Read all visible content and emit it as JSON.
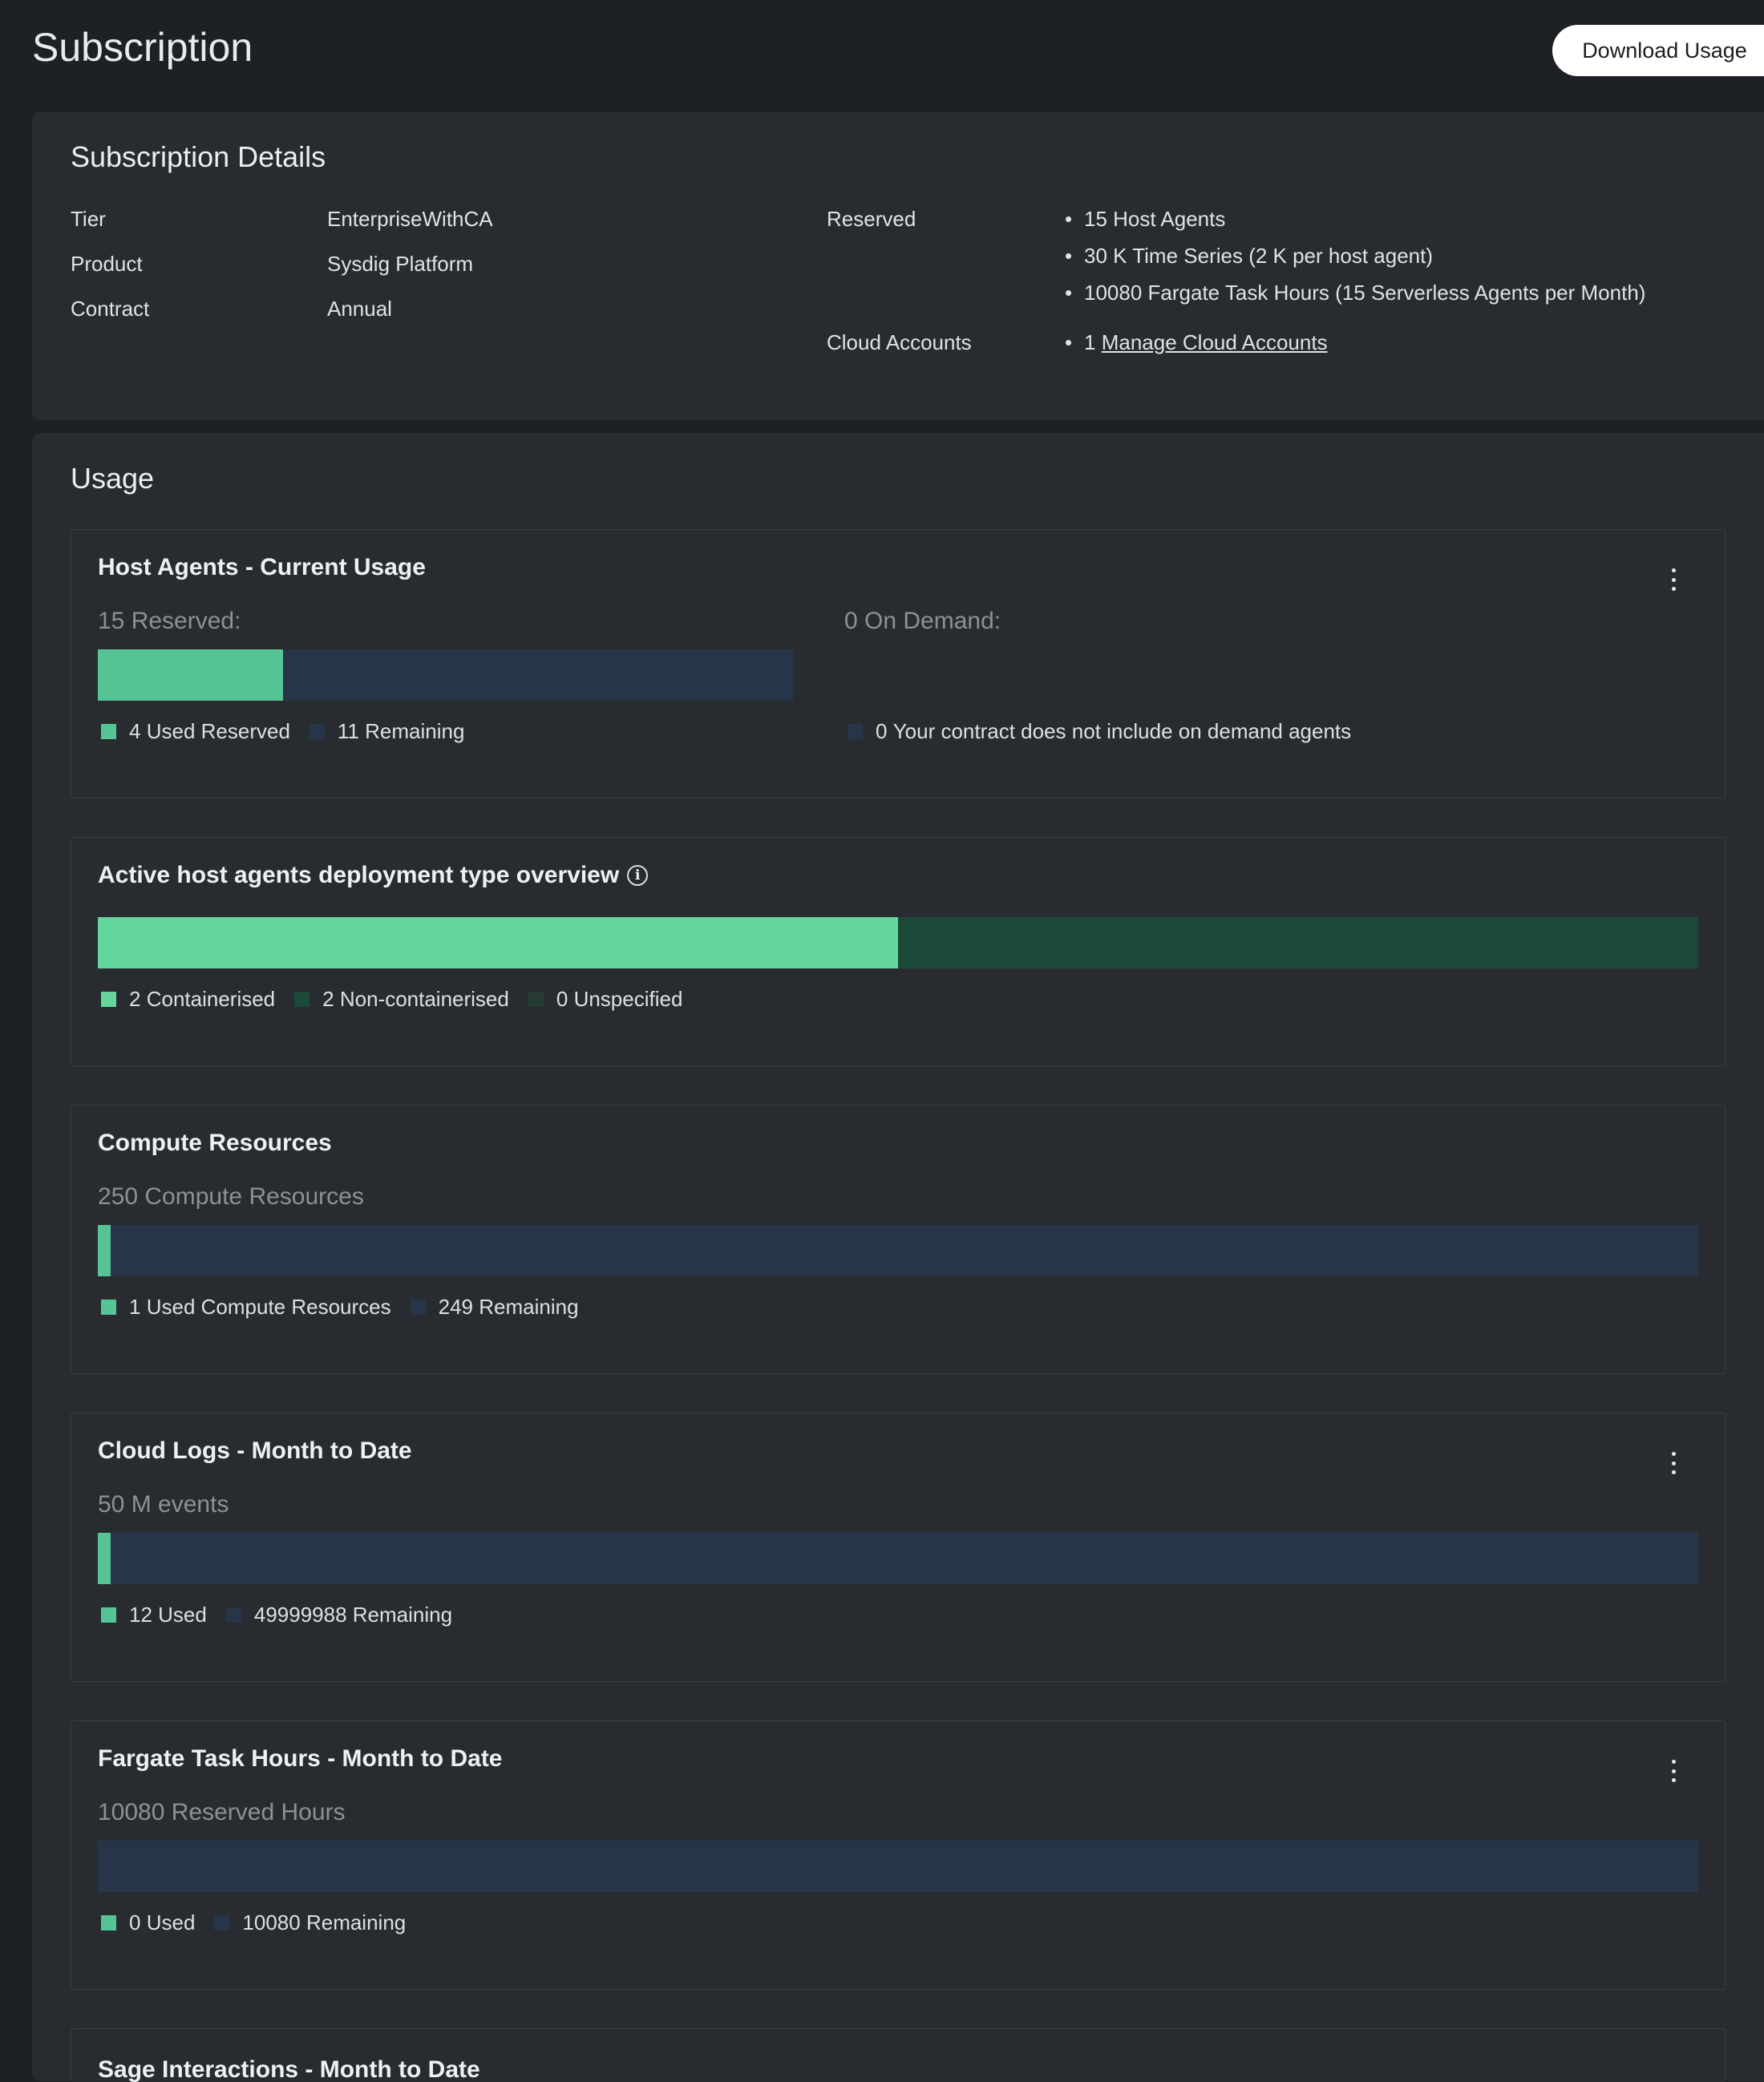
{
  "page": {
    "title": "Subscription",
    "download_label": "Download Usage"
  },
  "details": {
    "title": "Subscription Details",
    "rows": [
      {
        "label": "Tier",
        "value": "EnterpriseWithCA"
      },
      {
        "label": "Product",
        "value": "Sysdig Platform"
      },
      {
        "label": "Contract",
        "value": "Annual"
      }
    ],
    "reserved_label": "Reserved",
    "reserved_items": [
      "15 Host Agents",
      "30 K Time Series (2 K per host agent)",
      "10080 Fargate Task Hours (15 Serverless Agents per Month)"
    ],
    "cloud_label": "Cloud Accounts",
    "cloud_count": "1",
    "cloud_link": "Manage Cloud Accounts"
  },
  "usage": {
    "title": "Usage",
    "host_agents": {
      "title": "Host Agents - Current Usage",
      "reserved_heading": "15 Reserved:",
      "on_demand_heading": "0 On Demand:",
      "used_fraction": 0.2667,
      "used_count": "4",
      "used_label": "Used Reserved",
      "remaining_count": "11",
      "remaining_label": "Remaining",
      "on_demand_count": "0",
      "on_demand_label": "Your contract does not include on demand agents"
    },
    "deployment": {
      "title": "Active host agents deployment type overview",
      "containerised_fraction": 0.5,
      "items": [
        {
          "count": "2",
          "label": "Containerised",
          "color": "#63d79e"
        },
        {
          "count": "2",
          "label": "Non-containerised",
          "color": "#1b4a3a"
        },
        {
          "count": "0",
          "label": "Unspecified",
          "color": "#243b34"
        }
      ]
    },
    "compute": {
      "title": "Compute Resources",
      "subtitle": "250 Compute Resources",
      "used_fraction": 0.004,
      "used_count": "1",
      "used_label": "Used Compute Resources",
      "remaining_count": "249",
      "remaining_label": "Remaining"
    },
    "cloud_logs": {
      "title": "Cloud Logs - Month to Date",
      "subtitle": "50 M events",
      "used_fraction": 1e-06,
      "used_count": "12",
      "used_label": "Used",
      "remaining_count": "49999988",
      "remaining_label": "Remaining"
    },
    "fargate": {
      "title": "Fargate Task Hours - Month to Date",
      "subtitle": "10080 Reserved Hours",
      "used_fraction": 0,
      "used_count": "0",
      "used_label": "Used",
      "remaining_count": "10080",
      "remaining_label": "Remaining"
    },
    "sage": {
      "title": "Sage Interactions - Month to Date"
    }
  },
  "colors": {
    "used": "#55c596",
    "remaining": "#263547",
    "bg": "#1d2126",
    "panel": "#282c30"
  }
}
